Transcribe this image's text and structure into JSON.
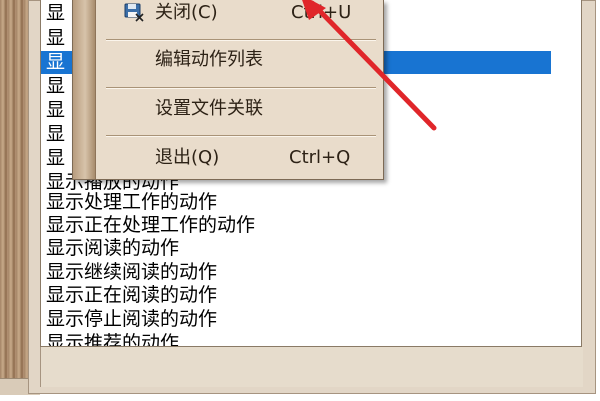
{
  "list": {
    "items": [
      "显",
      "显",
      "显",
      "显",
      "显",
      "显",
      "显",
      "显示播放的动作",
      "显示处理工作的动作",
      "显示正在处理工作的动作",
      "显示阅读的动作",
      "显示继续阅读的动作",
      "显示正在阅读的动作",
      "显示停止阅读的动作",
      "显示推荐的动作"
    ]
  },
  "context_menu": {
    "close_label": "关闭(C)",
    "close_shortcut": "Ctrl+U",
    "edit_actions_label": "编辑动作列表",
    "file_assoc_label": "设置文件关联",
    "exit_label": "退出(Q)",
    "exit_shortcut": "Ctrl+Q"
  },
  "colors": {
    "selection": "#1874d2",
    "annotation_arrow": "#e0262a",
    "scroll_thumb": "#e39a3f"
  },
  "icons": {
    "close_item": "disk-close-icon",
    "scroll_up": "scroll-up-icon",
    "scroll_down": "scroll-down-icon"
  }
}
